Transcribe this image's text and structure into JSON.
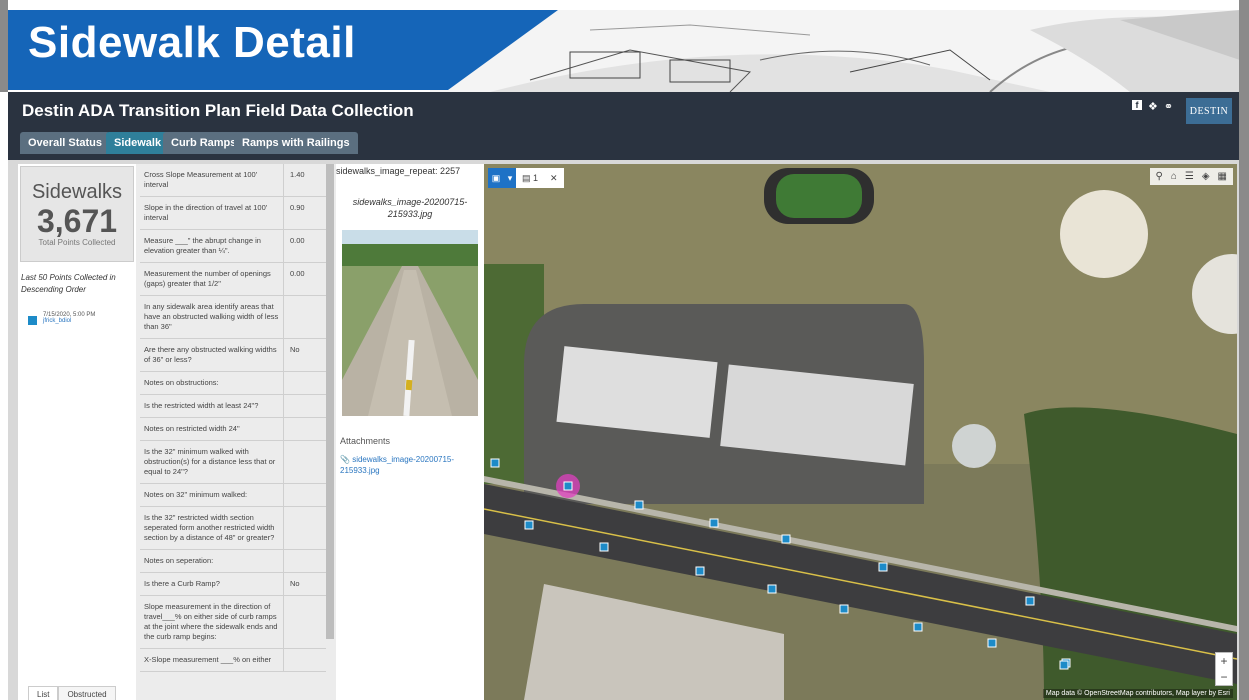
{
  "banner": {
    "title": "Sidewalk Detail"
  },
  "header": {
    "app_title": "Destin ADA Transition Plan Field Data Collection",
    "tabs": [
      {
        "label": "Overall Status"
      },
      {
        "label": "Sidewalk"
      },
      {
        "label": "Curb Ramps"
      },
      {
        "label": "Ramps with Railings"
      }
    ],
    "active_tab": "Sidewalk",
    "social_icons": [
      "facebook-icon",
      "twitter-icon",
      "link-icon"
    ],
    "logo_text": "DESTIN"
  },
  "summary": {
    "title": "Sidewalks",
    "value": "3,671",
    "subtitle": "Total Points Collected"
  },
  "list": {
    "header": "Last 50 Points Collected in Descending Order",
    "items": [
      {
        "date": "7/15/2020, 5:00 PM",
        "user": "jfrick_bdiol"
      }
    ],
    "tabs": [
      {
        "label": "List"
      },
      {
        "label": "Obstructed"
      }
    ]
  },
  "table": {
    "rows": [
      {
        "label": "Cross Slope Measurement at 100' interval",
        "value": "1.40"
      },
      {
        "label": "Slope in the direction of travel at 100' interval",
        "value": "0.90"
      },
      {
        "label": "Measure ___\" the abrupt change in elevation greater than ¼\".",
        "value": "0.00"
      },
      {
        "label": "Measurement the number of openings (gaps) greater that 1/2\"",
        "value": "0.00"
      },
      {
        "label": "In any sidewalk area identify areas that have an obstructed walking width of less than 36\"",
        "value": ""
      },
      {
        "label": "Are there any obstructed walking widths of 36\" or less?",
        "value": "No"
      },
      {
        "label": "Notes on obstructions:",
        "value": ""
      },
      {
        "label": "Is the restricted width at least 24\"?",
        "value": ""
      },
      {
        "label": "Notes on restricted width 24\"",
        "value": ""
      },
      {
        "label": "Is the 32\" minimum walked with obstruction(s) for a distance less that or equal to 24\"?",
        "value": ""
      },
      {
        "label": "Notes on 32\" minimum walked:",
        "value": ""
      },
      {
        "label": "Is the 32\" restricted width section seperated form another restricted width section by a distance of 48\" or greater?",
        "value": ""
      },
      {
        "label": "Notes on seperation:",
        "value": ""
      },
      {
        "label": "Is there a Curb Ramp?",
        "value": "No"
      },
      {
        "label": "Slope measurement in the direction of travel___% on either side of curb ramps at the joint where the sidewalk ends and the curb ramp begins:",
        "value": ""
      },
      {
        "label": "X-Slope measurement ___% on either",
        "value": ""
      }
    ]
  },
  "image_panel": {
    "repeat_label": "sidewalks_image_repeat: 2257",
    "image_name": "sidewalks_image-20200715-215933.jpg",
    "attachments_label": "Attachments",
    "attachment_link": "sidewalks_image-20200715-215933.jpg"
  },
  "map": {
    "toolbar_count": "1",
    "tools": [
      "search-icon",
      "home-icon",
      "list-icon",
      "layers-icon",
      "basemap-icon"
    ],
    "zoom_in": "+",
    "zoom_out": "−",
    "attribution": "Map data © OpenStreetMap contributors, Map layer by Esri"
  },
  "colors": {
    "banner_blue": "#1565b8",
    "header_dark": "#2a3340",
    "active_tab": "#2f7f9a",
    "tab": "#5b6f80",
    "point_marker": "#1d8bc8",
    "selected_marker": "#e040c0"
  }
}
